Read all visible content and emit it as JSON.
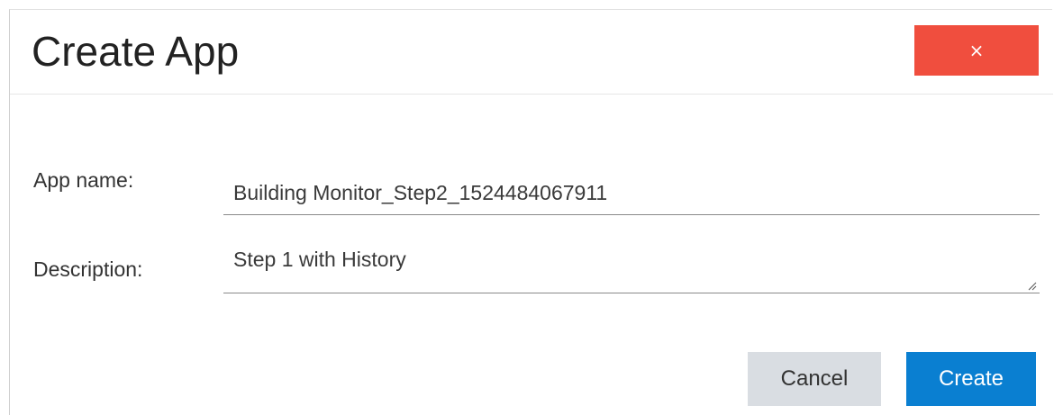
{
  "dialog": {
    "title": "Create App",
    "close_label": "×",
    "close_color": "#f04e3e"
  },
  "form": {
    "app_name": {
      "label": "App name:",
      "value": "Building Monitor_Step2_1524484067911"
    },
    "description": {
      "label": "Description:",
      "value": "Step 1 with History"
    }
  },
  "actions": {
    "cancel_label": "Cancel",
    "create_label": "Create",
    "create_color": "#0a7fd1"
  }
}
